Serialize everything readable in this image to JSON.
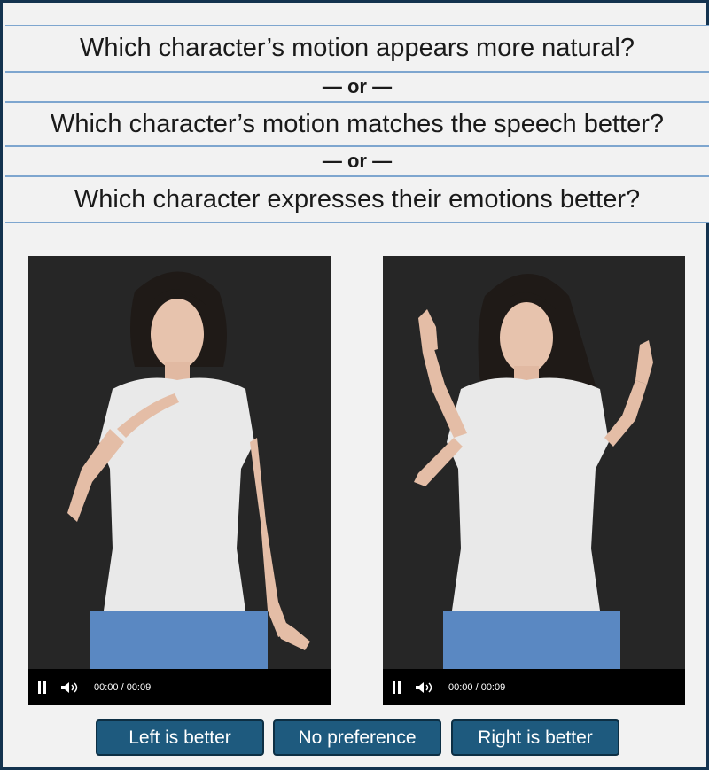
{
  "questions": {
    "q1": "Which character’s motion appears more natural?",
    "or1": "— or —",
    "q2": "Which character’s motion matches the speech better?",
    "or2": "— or —",
    "q3": "Which character expresses their emotions better?"
  },
  "videos": {
    "left": {
      "time": "00:00 / 00:09"
    },
    "right": {
      "time": "00:00 / 00:09"
    }
  },
  "buttons": {
    "left": "Left is better",
    "none": "No preference",
    "right": "Right is better"
  },
  "colors": {
    "frame": "#14334f",
    "button": "#1e5a7e",
    "video_bg": "#262626"
  },
  "icons": {
    "pause": "pause-icon",
    "volume": "volume-icon"
  }
}
